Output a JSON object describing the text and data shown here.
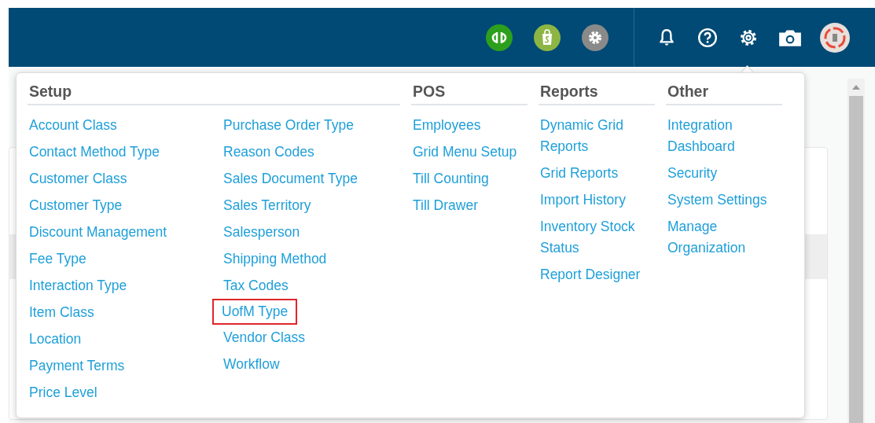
{
  "header": {
    "icons": [
      {
        "kind": "quickbooks"
      },
      {
        "kind": "shopify"
      },
      {
        "kind": "gear-round"
      },
      {
        "kind": "divider"
      },
      {
        "kind": "bell"
      },
      {
        "kind": "help"
      },
      {
        "kind": "settings"
      },
      {
        "kind": "camera"
      },
      {
        "kind": "avatar"
      }
    ]
  },
  "menu": {
    "sections": [
      {
        "title": "Setup",
        "columns": [
          [
            {
              "label": "Account Class",
              "highlighted": false
            },
            {
              "label": "Contact Method Type",
              "highlighted": false
            },
            {
              "label": "Customer Class",
              "highlighted": false
            },
            {
              "label": "Customer Type",
              "highlighted": false
            },
            {
              "label": "Discount Management",
              "highlighted": false
            },
            {
              "label": "Fee Type",
              "highlighted": false
            },
            {
              "label": "Interaction Type",
              "highlighted": false
            },
            {
              "label": "Item Class",
              "highlighted": false
            },
            {
              "label": "Location",
              "highlighted": false
            },
            {
              "label": "Payment Terms",
              "highlighted": false
            },
            {
              "label": "Price Level",
              "highlighted": false
            }
          ],
          [
            {
              "label": "Purchase Order Type",
              "highlighted": false
            },
            {
              "label": "Reason Codes",
              "highlighted": false
            },
            {
              "label": "Sales Document Type",
              "highlighted": false
            },
            {
              "label": "Sales Territory",
              "highlighted": false
            },
            {
              "label": "Salesperson",
              "highlighted": false
            },
            {
              "label": "Shipping Method",
              "highlighted": false
            },
            {
              "label": "Tax Codes",
              "highlighted": false
            },
            {
              "label": "UofM Type",
              "highlighted": true
            },
            {
              "label": "Vendor Class",
              "highlighted": false
            },
            {
              "label": "Workflow",
              "highlighted": false
            }
          ]
        ]
      },
      {
        "title": "POS",
        "columns": [
          [
            {
              "label": "Employees",
              "highlighted": false
            },
            {
              "label": "Grid Menu Setup",
              "highlighted": false
            },
            {
              "label": "Till Counting",
              "highlighted": false
            },
            {
              "label": "Till Drawer",
              "highlighted": false
            }
          ]
        ]
      },
      {
        "title": "Reports",
        "columns": [
          [
            {
              "label": "Dynamic Grid Reports",
              "highlighted": false
            },
            {
              "label": "Grid Reports",
              "highlighted": false
            },
            {
              "label": "Import History",
              "highlighted": false
            },
            {
              "label": "Inventory Stock Status",
              "highlighted": false
            },
            {
              "label": "Report Designer",
              "highlighted": false
            }
          ]
        ]
      },
      {
        "title": "Other",
        "columns": [
          [
            {
              "label": "Integration Dashboard",
              "highlighted": false
            },
            {
              "label": "Security",
              "highlighted": false
            },
            {
              "label": "System Settings",
              "highlighted": false
            },
            {
              "label": "Manage Organization",
              "highlighted": false
            }
          ]
        ]
      }
    ]
  }
}
